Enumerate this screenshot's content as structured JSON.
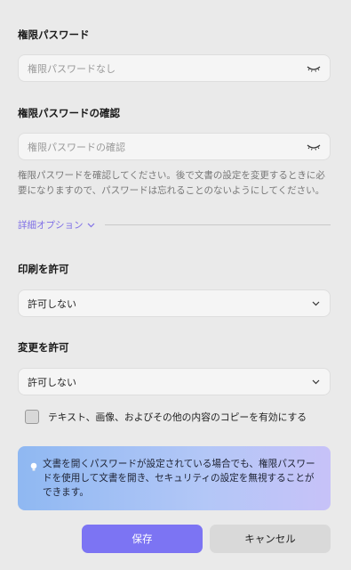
{
  "password": {
    "label": "権限パスワード",
    "placeholder": "権限パスワードなし"
  },
  "confirm": {
    "label": "権限パスワードの確認",
    "placeholder": "権限パスワードの確認",
    "hint": "権限パスワードを確認してください。後で文書の設定を変更するときに必要になりますので、パスワードは忘れることのないようにしてください。"
  },
  "advanced": {
    "label": "詳細オプション",
    "accent": "#7f6fe6"
  },
  "print": {
    "label": "印刷を許可",
    "value": "許可しない"
  },
  "change": {
    "label": "変更を許可",
    "value": "許可しない"
  },
  "copy_option": {
    "label": "テキスト、画像、およびその他の内容のコピーを有効にする",
    "checked": false
  },
  "info": {
    "icon": "lightbulb-icon",
    "text": "文書を開くパスワードが設定されている場合でも、権限パスワードを使用して文書を開き、セキュリティの設定を無視することができます。"
  },
  "buttons": {
    "save": "保存",
    "cancel": "キャンセル",
    "save_color": "#7c74f3"
  }
}
